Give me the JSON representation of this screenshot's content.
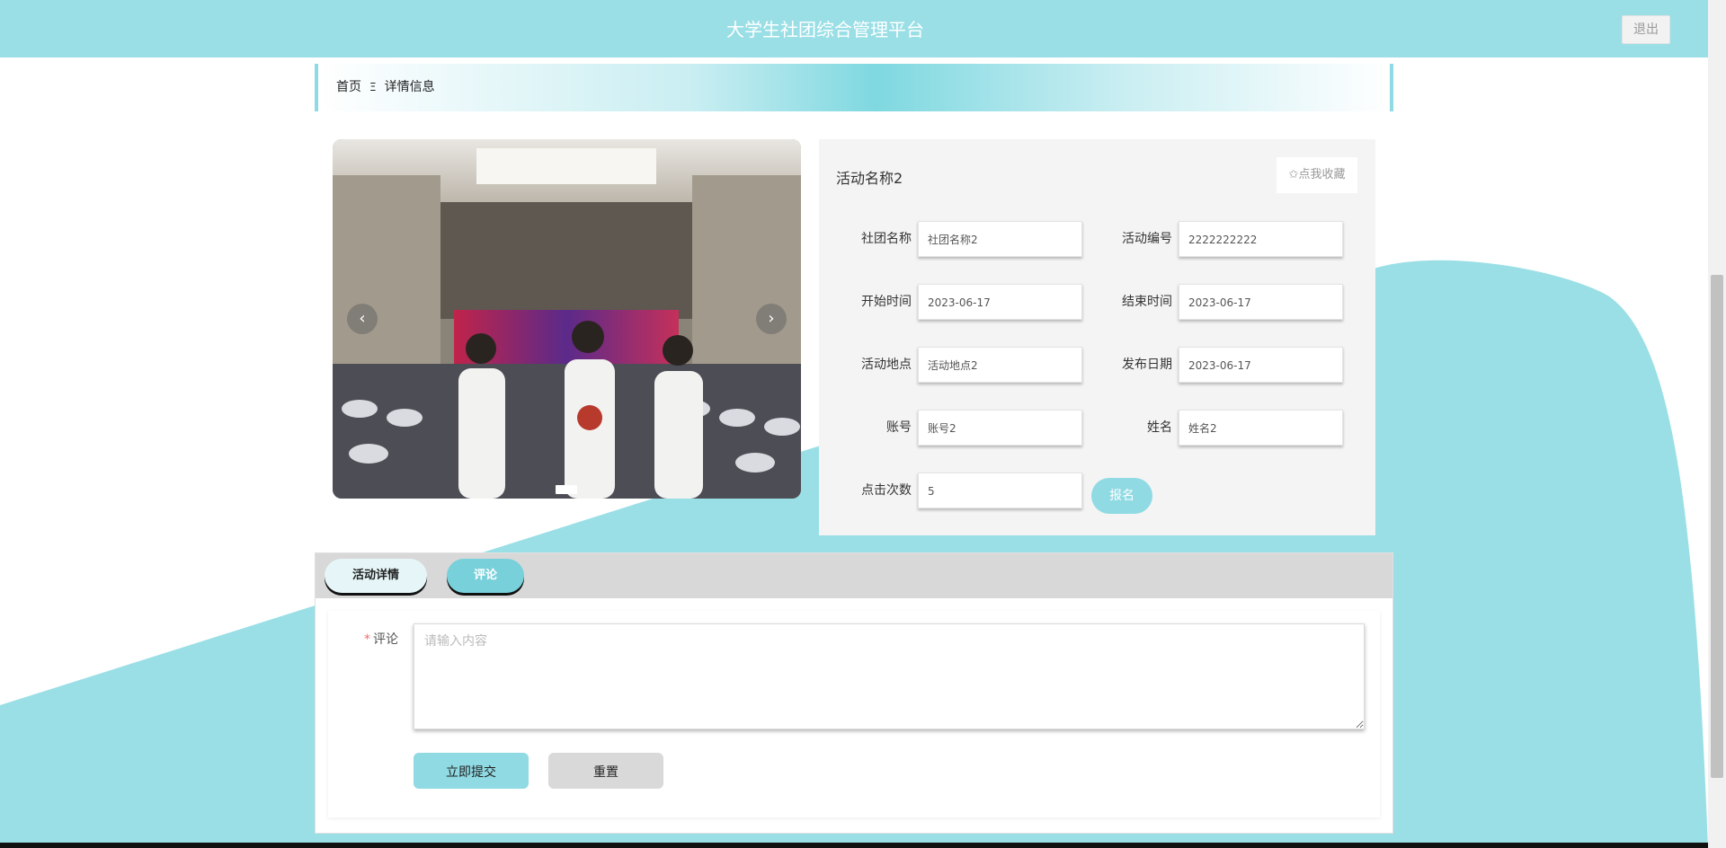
{
  "header": {
    "title": "大学生社团综合管理平台",
    "logout_label": "退出"
  },
  "breadcrumb": {
    "home": "首页",
    "separator": "Ξ",
    "current": "详情信息"
  },
  "carousel": {
    "prev_icon": "chevron-left-icon",
    "next_icon": "chevron-right-icon",
    "prev_glyph": "‹",
    "next_glyph": "›"
  },
  "detail": {
    "name": "活动名称2",
    "collect_label": "✩点我收藏",
    "fields": {
      "club_name": {
        "label": "社团名称",
        "value": "社团名称2"
      },
      "activity_no": {
        "label": "活动编号",
        "value": "2222222222"
      },
      "start_time": {
        "label": "开始时间",
        "value": "2023-06-17"
      },
      "end_time": {
        "label": "结束时间",
        "value": "2023-06-17"
      },
      "location": {
        "label": "活动地点",
        "value": "活动地点2"
      },
      "publish_date": {
        "label": "发布日期",
        "value": "2023-06-17"
      },
      "account": {
        "label": "账号",
        "value": "账号2"
      },
      "full_name": {
        "label": "姓名",
        "value": "姓名2"
      },
      "clicks": {
        "label": "点击次数",
        "value": "5"
      }
    },
    "signup_label": "报名"
  },
  "tabs": {
    "items": [
      {
        "label": "活动详情"
      },
      {
        "label": "评论"
      }
    ]
  },
  "comment": {
    "required_mark": "*",
    "label": "评论",
    "placeholder": "请输入内容",
    "submit_label": "立即提交",
    "reset_label": "重置"
  },
  "colors": {
    "accent": "#9adfe6",
    "accent_dark": "#78d0da",
    "panel": "#f4f4f4"
  }
}
